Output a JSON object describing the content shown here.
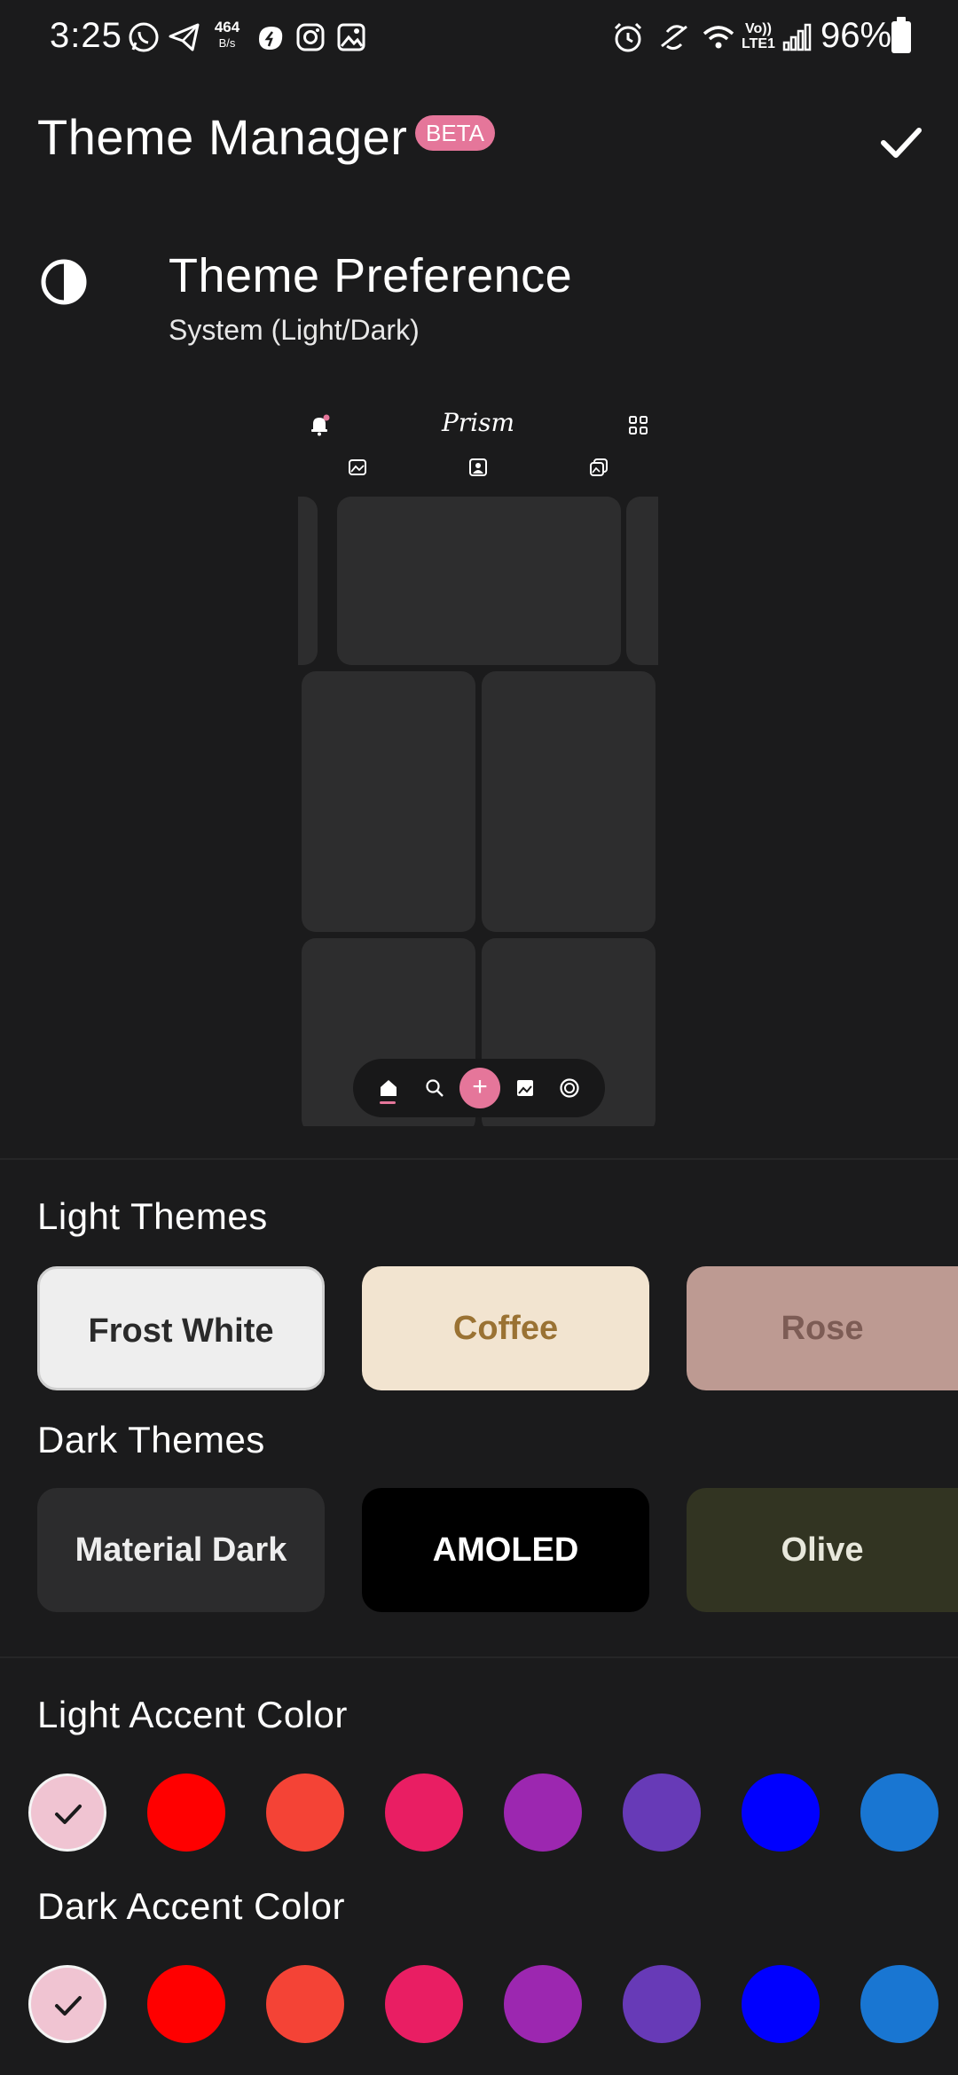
{
  "status_bar": {
    "time": "3:25",
    "net_speed_value": "464",
    "net_speed_unit": "B/s",
    "volte_top": "Vo))",
    "volte_bottom": "LTE1",
    "battery_pct": "96%"
  },
  "header": {
    "title": "Theme Manager",
    "badge": "BETA"
  },
  "theme_preference": {
    "title": "Theme Preference",
    "value": "System (Light/Dark)"
  },
  "preview": {
    "logo": "Prism",
    "add_symbol": "+"
  },
  "light_themes": {
    "title": "Light Themes",
    "items": [
      {
        "label": "Frost White",
        "bg": "#eeeeee",
        "fg": "#2a2a2a"
      },
      {
        "label": "Coffee",
        "bg": "#f2e4d0",
        "fg": "#9a7233"
      },
      {
        "label": "Rose",
        "bg": "#bd9a92",
        "fg": "#7d5c55"
      }
    ]
  },
  "dark_themes": {
    "title": "Dark Themes",
    "items": [
      {
        "label": "Material Dark",
        "bg": "#2c2c2d",
        "fg": "#eeeeee"
      },
      {
        "label": "AMOLED",
        "bg": "#000000",
        "fg": "#ffffff"
      },
      {
        "label": "Olive",
        "bg": "#323422",
        "fg": "#e8e8dc"
      }
    ]
  },
  "light_accent": {
    "title": "Light Accent Color",
    "colors": [
      "#f0c4d2",
      "#ff0000",
      "#f44336",
      "#e91e63",
      "#9c27b0",
      "#673ab7",
      "#0000ff",
      "#1976d2"
    ],
    "selected_index": 0
  },
  "dark_accent": {
    "title": "Dark Accent Color",
    "colors": [
      "#f0c4d2",
      "#ff0000",
      "#f44336",
      "#e91e63",
      "#9c27b0",
      "#673ab7",
      "#0000ff",
      "#1976d2"
    ],
    "selected_index": 0
  },
  "colors": {
    "background": "#1b1b1c",
    "accent_pink": "#e5769a"
  }
}
